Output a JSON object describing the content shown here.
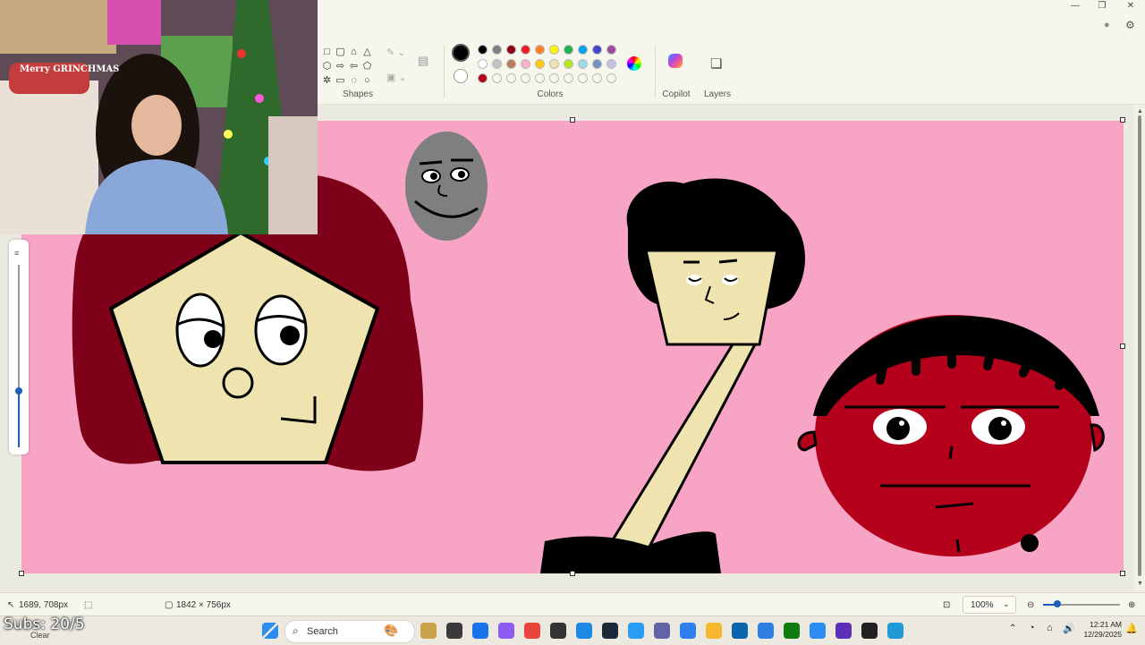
{
  "ribbon": {
    "shapes_label": "Shapes",
    "colors_label": "Colors",
    "copilot_label": "Copilot",
    "layers_label": "Layers",
    "palette_row1": [
      "#000000",
      "#7f7f7f",
      "#880015",
      "#ed1c24",
      "#ff7f27",
      "#fff200",
      "#22b14c",
      "#00a2e8",
      "#3f48cc",
      "#a349a4"
    ],
    "palette_row2": [
      "#ffffff",
      "#c3c3c3",
      "#b97a57",
      "#ffaec9",
      "#ffc90e",
      "#efe4b0",
      "#b5e61d",
      "#99d9ea",
      "#7092be",
      "#c8bfe7"
    ],
    "custom_color": "#b0001e",
    "primary_color": "#000000",
    "secondary_color": "#ffffff"
  },
  "status": {
    "cursor_pos": "1689, 708px",
    "canvas_size": "1842 × 756px",
    "zoom": "100%"
  },
  "taskbar": {
    "search_placeholder": "Search",
    "time": "12:21 AM",
    "date": "12/29/2025",
    "widget_label": "Clear",
    "pinned_apps": [
      "start-icon",
      "search-icon",
      "game-icon",
      "file-explorer-icon",
      "edge-icon",
      "copilot-icon",
      "chrome-icon",
      "epic-games-icon",
      "azure-icon",
      "steam-icon",
      "wave-icon",
      "teams-icon",
      "heart-app-icon",
      "folder-icon",
      "mail-icon",
      "store-icon",
      "xbox-icon",
      "paint-icon",
      "clipchamp-icon",
      "obs-icon",
      "paint-3d-icon"
    ]
  },
  "overlay": {
    "subs_text": "Subs: 20/5",
    "sweater_text": "Merry GRINCHMAS"
  },
  "colors": {
    "canvas_bg": "#f7a4c5",
    "hair_red": "#7f0019",
    "skin": "#efe4b0",
    "face_red": "#b5001c",
    "gray": "#7f7f7f"
  }
}
